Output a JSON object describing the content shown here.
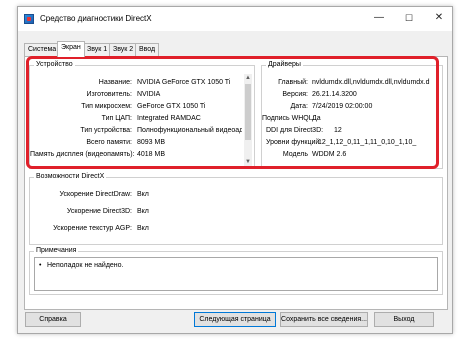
{
  "window": {
    "title": "Средство диагностики DirectX",
    "controls": {
      "minimize": "—",
      "maximize": "☐",
      "close": "✕"
    }
  },
  "tabs": [
    {
      "label": "Система"
    },
    {
      "label": "Экран",
      "active": true
    },
    {
      "label": "Звук 1"
    },
    {
      "label": "Звук 2"
    },
    {
      "label": "Ввод"
    }
  ],
  "device": {
    "title": "Устройство",
    "rows": [
      {
        "label": "Название:",
        "value": "NVIDIA GeForce GTX 1050 Ti"
      },
      {
        "label": "Изготовитель:",
        "value": "NVIDIA"
      },
      {
        "label": "Тип микросхем:",
        "value": "GeForce GTX 1050 Ti"
      },
      {
        "label": "Тип ЦАП:",
        "value": "Integrated RAMDAC"
      },
      {
        "label": "Тип устройства:",
        "value": "Полнофункциональный видеоадат"
      },
      {
        "label": "Всего памяти:",
        "value": "8093 MB"
      },
      {
        "label": "Память дисплея (видеопамять):",
        "value": "4018 MB"
      }
    ]
  },
  "drivers": {
    "title": "Драйверы",
    "rows": [
      {
        "label": "Главный:",
        "value": "nvldumdx.dll,nvldumdx.dll,nvldumdx.d"
      },
      {
        "label": "Версия:",
        "value": "26.21.14.3200"
      },
      {
        "label": "Дата:",
        "value": "7/24/2019 02:00:00"
      },
      {
        "label": "Подпись WHQL:",
        "value": "Да"
      },
      {
        "label": "DDI для Direct3D:",
        "value": "12"
      },
      {
        "label": "Уровни функций:",
        "value": "12_1,12_0,11_1,11_0,10_1,10_"
      },
      {
        "label": "Модель",
        "value": "WDDM 2.6"
      }
    ]
  },
  "directx": {
    "title": "Возможности DirectX",
    "rows": [
      {
        "label": "Ускорение DirectDraw:",
        "value": "Вкл"
      },
      {
        "label": "Ускорение Direct3D:",
        "value": "Вкл"
      },
      {
        "label": "Ускорение текстур AGP:",
        "value": "Вкл"
      }
    ]
  },
  "notes": {
    "title": "Примечания",
    "items": [
      "Неполадок не найдено."
    ]
  },
  "buttons": {
    "help": "Справка",
    "next": "Следующая страница",
    "save": "Сохранить все сведения...",
    "exit": "Выход"
  },
  "colors": {
    "highlight": "#e0202a",
    "default_button_border": "#0078d7"
  }
}
